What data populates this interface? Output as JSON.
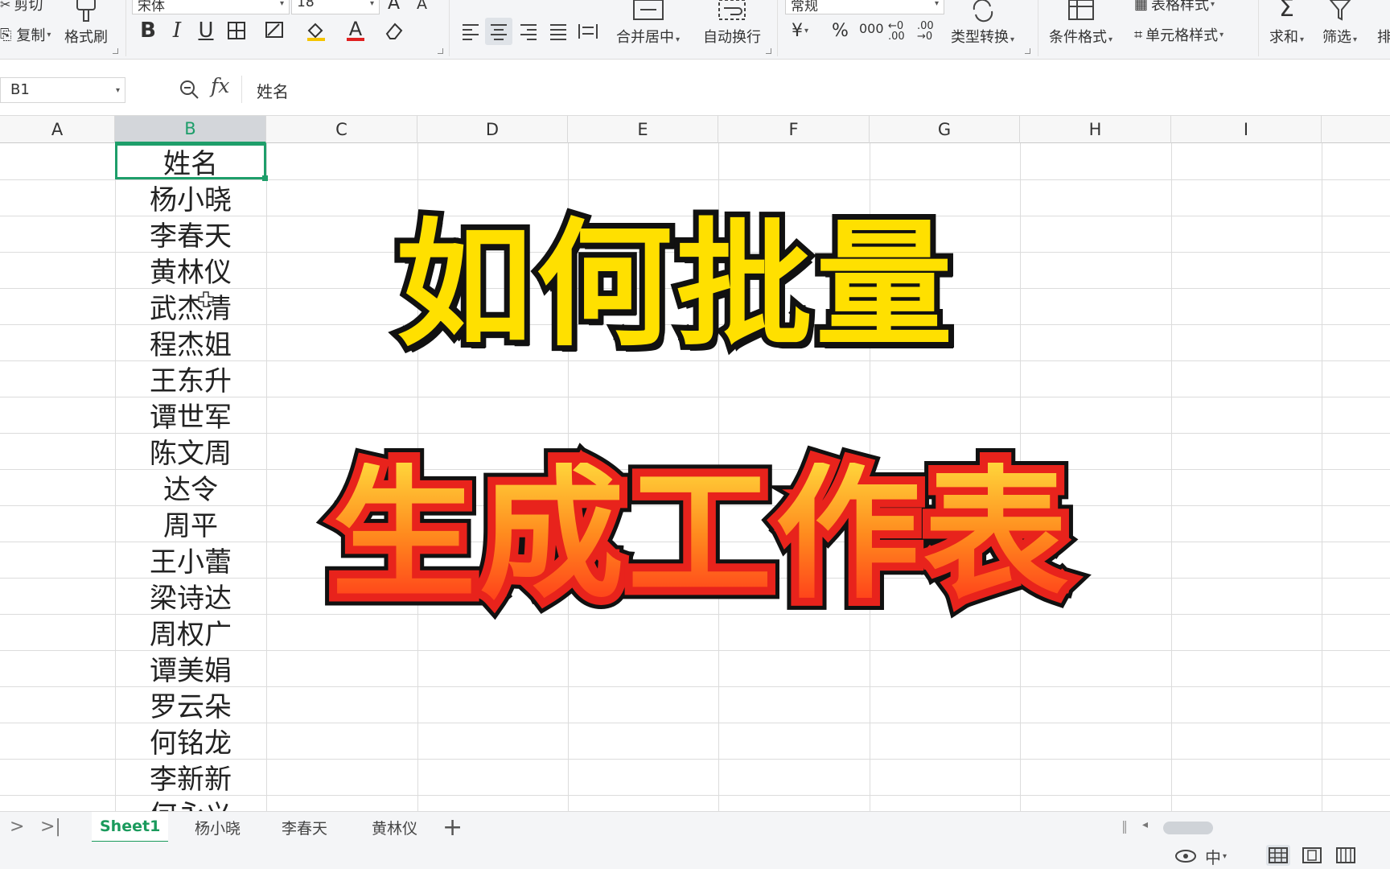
{
  "ribbon": {
    "cut_label": "剪切",
    "copy_label": "复制",
    "format_painter_label": "格式刷",
    "font_name": "宋体",
    "font_size": "18",
    "font_grow": "A",
    "font_shrink": "A",
    "bold": "B",
    "italic": "I",
    "underline": "U",
    "font_color_letter": "A",
    "merge_label": "合并居中",
    "wrap_label": "自动换行",
    "number_format": "常规",
    "currency": "¥",
    "percent": "%",
    "thousands": "000",
    "dec_increase": "←0 .00",
    "dec_decrease": ".00 →0",
    "type_convert_label": "类型转换",
    "cond_format_label": "条件格式",
    "table_style_label": "表格样式",
    "cell_style_label": "单元格样式",
    "sum_label": "求和",
    "filter_label": "筛选",
    "sort_label": "排"
  },
  "formula_bar": {
    "cell_ref": "B1",
    "fx": "fx",
    "content": "姓名"
  },
  "columns": [
    "A",
    "B",
    "C",
    "D",
    "E",
    "F",
    "G",
    "H",
    "I"
  ],
  "selected_column": "B",
  "cells_b": [
    "姓名",
    "杨小晓",
    "李春天",
    "黄林仪",
    "武杰清",
    "程杰姐",
    "王东升",
    "谭世军",
    "陈文周",
    "达令",
    "周平",
    "王小蕾",
    "梁诗达",
    "周权广",
    "谭美娟",
    "罗云朵",
    "何铭龙",
    "李新新",
    "何永义"
  ],
  "overlay": {
    "line1": "如何批量",
    "line2": "生成工作表"
  },
  "sheet_tabs": [
    "Sheet1",
    "杨小晓",
    "李春天",
    "黄林仪"
  ],
  "active_tab": "Sheet1",
  "add_tab": "+",
  "status": {
    "input_method": "中"
  },
  "colors": {
    "accent_green": "#1e9e6a",
    "title_yellow": "#ffe000",
    "title_orange": "#ff6a1a",
    "title_red_stroke": "#e8231c"
  }
}
